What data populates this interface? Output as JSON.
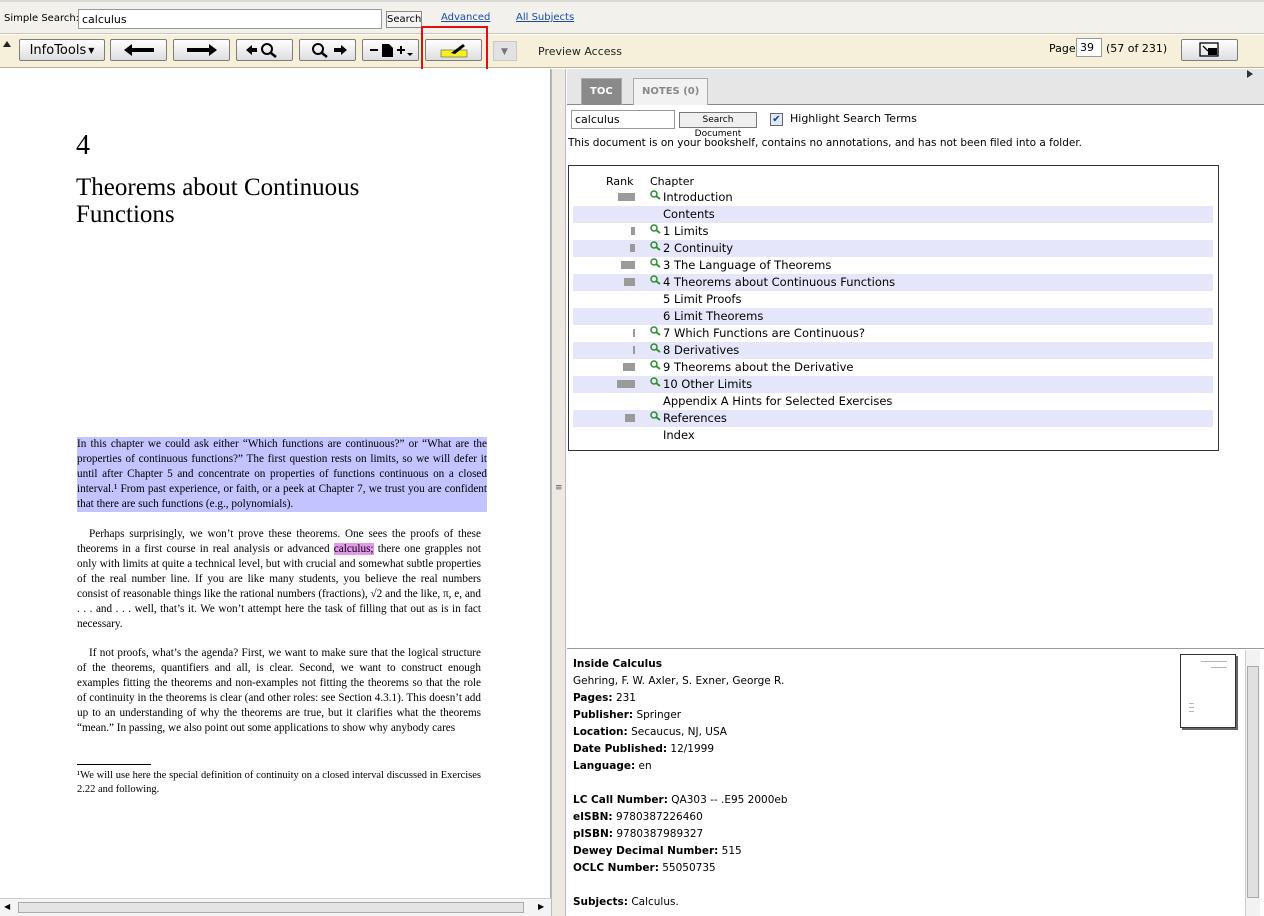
{
  "search": {
    "label": "Simple Search:",
    "value": "calculus",
    "button": "Search",
    "advanced": "Advanced",
    "all_subjects": "All Subjects"
  },
  "toolbar": {
    "infotools": "InfoTools",
    "preview": "Preview Access",
    "page_label": "Page",
    "page_value": "39",
    "page_count": "(57 of 231)"
  },
  "doc": {
    "chapter_number": "4",
    "chapter_title": "Theorems about Continuous Functions",
    "p1": "In this chapter we could ask either “Which functions are continuous?” or “What are the properties of continuous functions?” The first question rests on limits, so we will defer it until after Chapter 5 and concentrate on properties of functions continuous on a closed interval.¹ From past experience, or faith, or a peek at Chapter 7, we trust you are confident that there are such functions (e.g., polynomials).",
    "p2a": "Perhaps surprisingly, we won’t prove these theorems. One sees the proofs of these theorems in a first course in real analysis or advanced ",
    "p2_highlight": "calculus;",
    "p2b": " there one grapples not only with limits at quite a technical level, but with crucial and somewhat subtle properties of the real number line. If you are like many students, you believe the real numbers consist of reasonable things like the rational numbers (fractions), √2 and the like, π, e, and . . . and . . . well, that’s it. We won’t attempt here the task of filling that out as is in fact necessary.",
    "p3": "If not proofs, what’s the agenda? First, we want to make sure that the logical structure of the theorems, quantifiers and all, is clear. Second, we want to construct enough examples fitting the theorems and non-examples not fitting the theorems so that the role of continuity in the theorems is clear (and other roles: see Section 4.3.1). This doesn’t add up to an understanding of why the theorems are true, but it clarifies what the theorems “mean.” In passing, we also point out some applications to show why anybody cares",
    "footnote": "¹We will use here the special definition of continuity on a closed interval discussed in Exercises 2.22 and following."
  },
  "tabs": {
    "toc": "TOC",
    "notes": "NOTES (0)"
  },
  "docsearch": {
    "value": "calculus",
    "button": "Search Document",
    "highlight_label": "Highlight Search Terms",
    "highlight_checked": "✔"
  },
  "shelf_message": "This document is on your bookshelf, contains no annotations, and has not been filed into a folder.",
  "toc": {
    "rank_header": "Rank",
    "chapter_header": "Chapter",
    "rows": [
      {
        "title": "Introduction",
        "rank": 0.7,
        "hit": true
      },
      {
        "title": "Contents",
        "rank": 0,
        "hit": false
      },
      {
        "title": "1 Limits",
        "rank": 0.15,
        "hit": true
      },
      {
        "title": "2 Continuity",
        "rank": 0.2,
        "hit": true
      },
      {
        "title": "3 The Language of Theorems",
        "rank": 0.6,
        "hit": true
      },
      {
        "title": "4 Theorems about Continuous Functions",
        "rank": 0.45,
        "hit": true
      },
      {
        "title": "5 Limit Proofs",
        "rank": 0,
        "hit": false
      },
      {
        "title": "6 Limit Theorems",
        "rank": 0,
        "hit": false
      },
      {
        "title": "7 Which Functions are Continuous?",
        "rank": 0.08,
        "hit": true
      },
      {
        "title": "8 Derivatives",
        "rank": 0.08,
        "hit": true
      },
      {
        "title": "9 Theorems about the Derivative",
        "rank": 0.5,
        "hit": true
      },
      {
        "title": "10 Other Limits",
        "rank": 0.75,
        "hit": true
      },
      {
        "title": "Appendix A Hints for Selected Exercises",
        "rank": 0,
        "hit": false
      },
      {
        "title": "References",
        "rank": 0.4,
        "hit": true
      },
      {
        "title": "Index",
        "rank": 0,
        "hit": false
      }
    ]
  },
  "book": {
    "title": "Inside Calculus",
    "authors": "Gehring, F. W. Axler, S. Exner, George R.",
    "pages_label": "Pages:",
    "pages": "231",
    "publisher_label": "Publisher:",
    "publisher": "Springer",
    "location_label": "Location:",
    "location": "Secaucus, NJ, USA",
    "date_label": "Date Published:",
    "date": "12/1999",
    "language_label": "Language:",
    "language": "en",
    "lc_label": "LC Call Number:",
    "lc": "QA303 -- .E95 2000eb",
    "eisbn_label": "eISBN:",
    "eisbn": "9780387226460",
    "pisbn_label": "pISBN:",
    "pisbn": "9780387989327",
    "dewey_label": "Dewey Decimal Number:",
    "dewey": "515",
    "oclc_label": "OCLC Number:",
    "oclc": "55050735",
    "subjects_label": "Subjects:",
    "subjects": "Calculus."
  },
  "colors": {
    "selection": "#c3c3ff",
    "search_highlight": "#e199e8",
    "toc_row_shade": "#e6e6fa",
    "highlighter_button": "#f5f020",
    "callout": "#e01010"
  }
}
